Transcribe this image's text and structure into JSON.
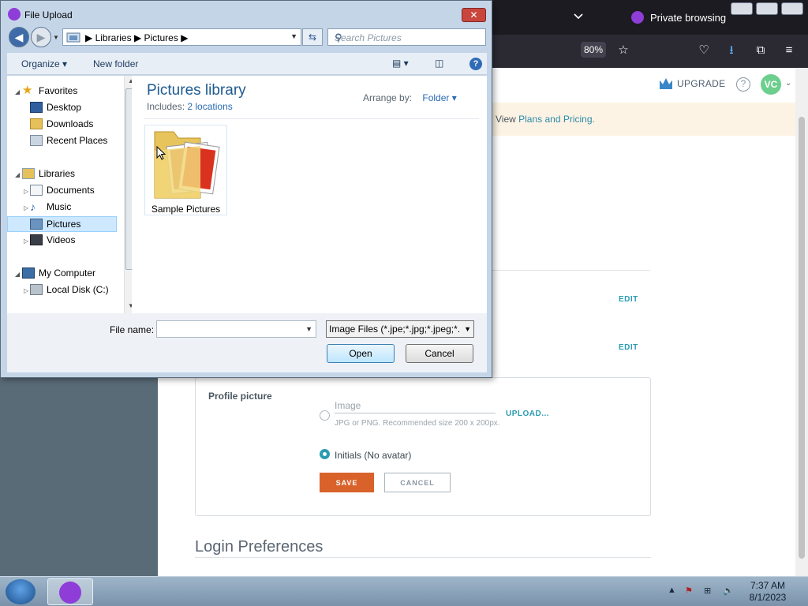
{
  "browser": {
    "private_label": "Private browsing",
    "zoom": "80%",
    "upgrade_label": "UPGRADE",
    "help_symbol": "?",
    "avatar_initials": "VC",
    "banner_text": "View ",
    "banner_link": "Plans and Pricing.",
    "edit_label_1": "EDIT",
    "edit_label_2": "EDIT",
    "profile_picture_label": "Profile picture",
    "image_field_label": "Image",
    "image_hint": "JPG or PNG. Recommended size 200 x 200px.",
    "upload_label": "UPLOAD...",
    "initials_option": "Initials (No avatar)",
    "save_label": "SAVE",
    "cancel_label": "CANCEL",
    "login_heading": "Login Preferences"
  },
  "dialog": {
    "title": "File Upload",
    "close_symbol": "✕",
    "breadcrumb": [
      "Libraries",
      "Pictures"
    ],
    "search_placeholder": "Search Pictures",
    "organize_label": "Organize",
    "new_folder_label": "New folder",
    "nav": {
      "favorites": "Favorites",
      "desktop": "Desktop",
      "downloads": "Downloads",
      "recent_places": "Recent Places",
      "libraries": "Libraries",
      "documents": "Documents",
      "music": "Music",
      "pictures": "Pictures",
      "videos": "Videos",
      "my_computer": "My Computer",
      "local_disk": "Local Disk (C:)"
    },
    "library_title": "Pictures library",
    "includes_prefix": "Includes:",
    "includes_link": "2 locations",
    "arrange_by_label": "Arrange by:",
    "arrange_by_value": "Folder",
    "folder_item": "Sample Pictures",
    "file_name_label": "File name:",
    "file_name_value": "",
    "file_type": "Image Files (*.jpe;*.jpg;*.jpeg;*.",
    "open_label": "Open",
    "cancel_label": "Cancel"
  },
  "taskbar": {
    "time": "7:37 AM",
    "date": "8/1/2023"
  }
}
